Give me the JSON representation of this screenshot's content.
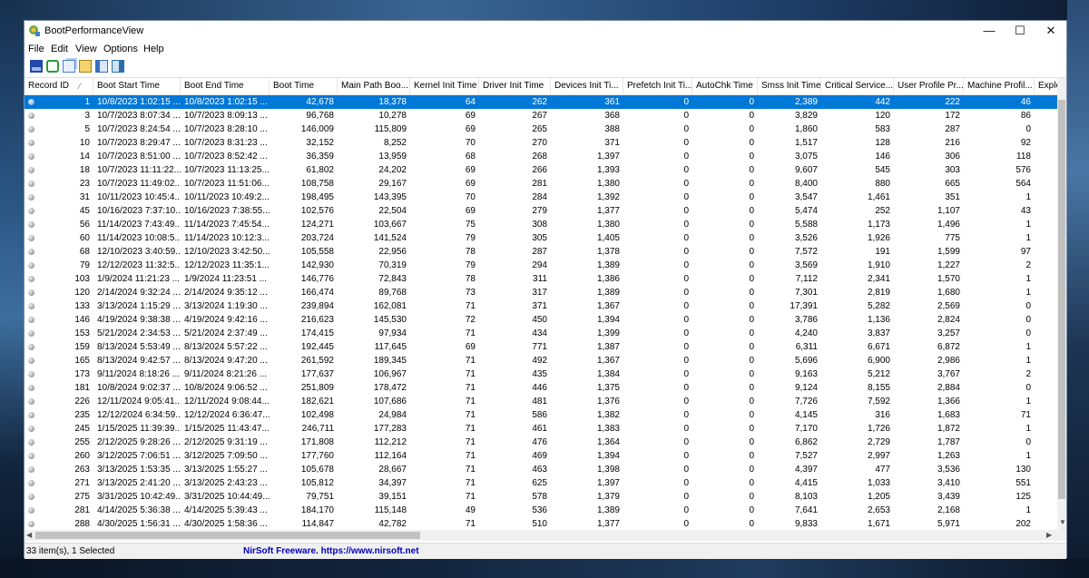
{
  "window": {
    "title": "BootPerformanceView"
  },
  "controls": {
    "minimize": "—",
    "maximize": "☐",
    "close": "✕"
  },
  "menu": [
    "File",
    "Edit",
    "View",
    "Options",
    "Help"
  ],
  "toolbar": [
    {
      "name": "save-icon",
      "color": "#1f4aa8"
    },
    {
      "name": "refresh-icon",
      "color": "#2a9a3a"
    },
    {
      "name": "copy-icon",
      "color": "#4a7fd0"
    },
    {
      "name": "properties-icon",
      "color": "#c8a030"
    },
    {
      "name": "html-report-icon",
      "color": "#3a6ec0"
    },
    {
      "name": "exit-icon",
      "color": "#2a6fa8"
    }
  ],
  "columns": [
    "Record ID",
    "Boot Start Time",
    "Boot End Time",
    "Boot Time",
    "Main Path Boo...",
    "Kernel Init Time",
    "Driver Init Time",
    "Devices Init Ti...",
    "Prefetch Init Ti...",
    "AutoChk Time",
    "Smss Init Time",
    "Critical Service...",
    "User Profile Pr...",
    "Machine Profil...",
    "Explorer In"
  ],
  "sort_indicator": "⁄",
  "rows": [
    [
      "1",
      "10/8/2023 1:02:15 ...",
      "10/8/2023 1:02:15 ...",
      "42,678",
      "18,378",
      "64",
      "262",
      "361",
      "0",
      "0",
      "2,389",
      "442",
      "222",
      "46",
      ""
    ],
    [
      "3",
      "10/7/2023 8:07:34 ...",
      "10/7/2023 8:09:13 ...",
      "96,768",
      "10,278",
      "69",
      "267",
      "368",
      "0",
      "0",
      "3,829",
      "120",
      "172",
      "86",
      ""
    ],
    [
      "5",
      "10/7/2023 8:24:54 ...",
      "10/7/2023 8:28:10 ...",
      "146,009",
      "115,809",
      "69",
      "265",
      "388",
      "0",
      "0",
      "1,860",
      "583",
      "287",
      "0",
      ""
    ],
    [
      "10",
      "10/7/2023 8:29:47 ...",
      "10/7/2023 8:31:23 ...",
      "32,152",
      "8,252",
      "70",
      "270",
      "371",
      "0",
      "0",
      "1,517",
      "128",
      "216",
      "92",
      ""
    ],
    [
      "14",
      "10/7/2023 8:51:00 ...",
      "10/7/2023 8:52:42 ...",
      "36,359",
      "13,959",
      "68",
      "268",
      "1,397",
      "0",
      "0",
      "3,075",
      "146",
      "306",
      "118",
      ""
    ],
    [
      "18",
      "10/7/2023 11:11:22...",
      "10/7/2023 11:13:25...",
      "61,802",
      "24,202",
      "69",
      "266",
      "1,393",
      "0",
      "0",
      "9,607",
      "545",
      "303",
      "576",
      ""
    ],
    [
      "23",
      "10/7/2023 11:49:02...",
      "10/7/2023 11:51:06...",
      "108,758",
      "29,167",
      "69",
      "281",
      "1,380",
      "0",
      "0",
      "8,400",
      "880",
      "665",
      "564",
      ""
    ],
    [
      "31",
      "10/11/2023 10:45:4...",
      "10/11/2023 10:49:2...",
      "198,495",
      "143,395",
      "70",
      "284",
      "1,392",
      "0",
      "0",
      "3,547",
      "1,461",
      "351",
      "1",
      ""
    ],
    [
      "45",
      "10/16/2023 7:37:10...",
      "10/16/2023 7:38:55...",
      "102,576",
      "22,504",
      "69",
      "279",
      "1,377",
      "0",
      "0",
      "5,474",
      "252",
      "1,107",
      "43",
      ""
    ],
    [
      "56",
      "11/14/2023 7:43:49...",
      "11/14/2023 7:45:54...",
      "124,271",
      "103,667",
      "75",
      "308",
      "1,380",
      "0",
      "0",
      "5,588",
      "1,173",
      "1,496",
      "1",
      ""
    ],
    [
      "60",
      "11/14/2023 10:08:5...",
      "11/14/2023 10:12:3...",
      "203,724",
      "141,524",
      "79",
      "305",
      "1,405",
      "0",
      "0",
      "3,526",
      "1,926",
      "775",
      "1",
      ""
    ],
    [
      "68",
      "12/10/2023 3:40:59...",
      "12/10/2023 3:42:50...",
      "105,558",
      "22,956",
      "78",
      "287",
      "1,378",
      "0",
      "0",
      "7,572",
      "191",
      "1,599",
      "97",
      ""
    ],
    [
      "79",
      "12/12/2023 11:32:5...",
      "12/12/2023 11:35:1...",
      "142,930",
      "70,319",
      "79",
      "294",
      "1,389",
      "0",
      "0",
      "3,569",
      "1,910",
      "1,227",
      "2",
      ""
    ],
    [
      "103",
      "1/9/2024 11:21:23 ...",
      "1/9/2024 11:23:51 ...",
      "146,776",
      "72,843",
      "78",
      "311",
      "1,386",
      "0",
      "0",
      "7,112",
      "2,341",
      "1,570",
      "1",
      ""
    ],
    [
      "120",
      "2/14/2024 9:32:24 ...",
      "2/14/2024 9:35:12 ...",
      "166,474",
      "89,768",
      "73",
      "317",
      "1,389",
      "0",
      "0",
      "7,301",
      "2,819",
      "1,680",
      "1",
      ""
    ],
    [
      "133",
      "3/13/2024 1:15:29 ...",
      "3/13/2024 1:19:30 ...",
      "239,894",
      "162,081",
      "71",
      "371",
      "1,367",
      "0",
      "0",
      "17,391",
      "5,282",
      "2,569",
      "0",
      ""
    ],
    [
      "146",
      "4/19/2024 9:38:38 ...",
      "4/19/2024 9:42:16 ...",
      "216,623",
      "145,530",
      "72",
      "450",
      "1,394",
      "0",
      "0",
      "3,786",
      "1,136",
      "2,824",
      "0",
      ""
    ],
    [
      "153",
      "5/21/2024 2:34:53 ...",
      "5/21/2024 2:37:49 ...",
      "174,415",
      "97,934",
      "71",
      "434",
      "1,399",
      "0",
      "0",
      "4,240",
      "3,837",
      "3,257",
      "0",
      ""
    ],
    [
      "159",
      "8/13/2024 5:53:49 ...",
      "8/13/2024 5:57:22 ...",
      "192,445",
      "117,645",
      "69",
      "771",
      "1,387",
      "0",
      "0",
      "6,311",
      "6,671",
      "6,872",
      "1",
      ""
    ],
    [
      "165",
      "8/13/2024 9:42:57 ...",
      "8/13/2024 9:47:20 ...",
      "261,592",
      "189,345",
      "71",
      "492",
      "1,367",
      "0",
      "0",
      "5,696",
      "6,900",
      "2,986",
      "1",
      ""
    ],
    [
      "173",
      "9/11/2024 8:18:26 ...",
      "9/11/2024 8:21:26 ...",
      "177,637",
      "106,967",
      "71",
      "435",
      "1,384",
      "0",
      "0",
      "9,163",
      "5,212",
      "3,767",
      "2",
      ""
    ],
    [
      "181",
      "10/8/2024 9:02:37 ...",
      "10/8/2024 9:06:52 ...",
      "251,809",
      "178,472",
      "71",
      "446",
      "1,375",
      "0",
      "0",
      "9,124",
      "8,155",
      "2,884",
      "0",
      ""
    ],
    [
      "226",
      "12/11/2024 9:05:41...",
      "12/11/2024 9:08:44...",
      "182,621",
      "107,686",
      "71",
      "481",
      "1,376",
      "0",
      "0",
      "7,726",
      "7,592",
      "1,366",
      "1",
      ""
    ],
    [
      "235",
      "12/12/2024 6:34:59...",
      "12/12/2024 6:36:47...",
      "102,498",
      "24,984",
      "71",
      "586",
      "1,382",
      "0",
      "0",
      "4,145",
      "316",
      "1,683",
      "71",
      ""
    ],
    [
      "245",
      "1/15/2025 11:39:39...",
      "1/15/2025 11:43:47...",
      "246,711",
      "177,283",
      "71",
      "461",
      "1,383",
      "0",
      "0",
      "7,170",
      "1,726",
      "1,872",
      "1",
      ""
    ],
    [
      "255",
      "2/12/2025 9:28:26 ...",
      "2/12/2025 9:31:19 ...",
      "171,808",
      "112,212",
      "71",
      "476",
      "1,364",
      "0",
      "0",
      "6,862",
      "2,729",
      "1,787",
      "0",
      ""
    ],
    [
      "260",
      "3/12/2025 7:06:51 ...",
      "3/12/2025 7:09:50 ...",
      "177,760",
      "112,164",
      "71",
      "469",
      "1,394",
      "0",
      "0",
      "7,527",
      "2,997",
      "1,263",
      "1",
      ""
    ],
    [
      "263",
      "3/13/2025 1:53:35 ...",
      "3/13/2025 1:55:27 ...",
      "105,678",
      "28,667",
      "71",
      "463",
      "1,398",
      "0",
      "0",
      "4,397",
      "477",
      "3,536",
      "130",
      ""
    ],
    [
      "271",
      "3/13/2025 2:41:20 ...",
      "3/13/2025 2:43:23 ...",
      "105,812",
      "34,397",
      "71",
      "625",
      "1,397",
      "0",
      "0",
      "4,415",
      "1,033",
      "3,410",
      "551",
      ""
    ],
    [
      "275",
      "3/31/2025 10:42:49...",
      "3/31/2025 10:44:49...",
      "79,751",
      "39,151",
      "71",
      "578",
      "1,379",
      "0",
      "0",
      "8,103",
      "1,205",
      "3,439",
      "125",
      ""
    ],
    [
      "281",
      "4/14/2025 5:36:38 ...",
      "4/14/2025 5:39:43 ...",
      "184,170",
      "115,148",
      "49",
      "536",
      "1,389",
      "0",
      "0",
      "7,641",
      "2,653",
      "2,168",
      "1",
      ""
    ],
    [
      "288",
      "4/30/2025 1:56:31 ...",
      "4/30/2025 1:58:36 ...",
      "114,847",
      "42,782",
      "71",
      "510",
      "1,377",
      "0",
      "0",
      "9,833",
      "1,671",
      "5,971",
      "202",
      ""
    ]
  ],
  "selected_row": 0,
  "status": {
    "count": "33 item(s), 1 Selected",
    "link": "NirSoft Freeware. https://www.nirsoft.net"
  }
}
